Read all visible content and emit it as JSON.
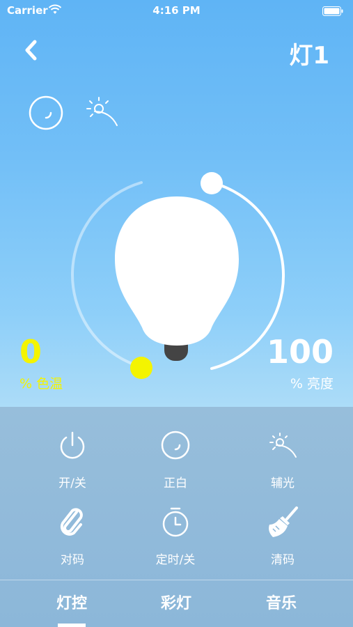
{
  "status_bar": {
    "carrier": "Carrier",
    "time": "4:16 PM"
  },
  "header": {
    "title": "灯1"
  },
  "modes": [
    {
      "icon": "white-light-icon"
    },
    {
      "icon": "auxiliary-light-icon"
    }
  ],
  "readouts": {
    "color_temp": {
      "value": "0",
      "label": "% 色温",
      "color": "#f4f400"
    },
    "brightness": {
      "value": "100",
      "label": "% 亮度"
    }
  },
  "controls": [
    {
      "label": "开/关",
      "icon": "power-icon"
    },
    {
      "label": "正白",
      "icon": "white-light-icon"
    },
    {
      "label": "辅光",
      "icon": "auxiliary-light-icon"
    },
    {
      "label": "对码",
      "icon": "pair-link-icon"
    },
    {
      "label": "定时/关",
      "icon": "timer-icon"
    },
    {
      "label": "清码",
      "icon": "clear-broom-icon"
    }
  ],
  "tabs": [
    {
      "label": "灯控",
      "active": true
    },
    {
      "label": "彩灯",
      "active": false
    },
    {
      "label": "音乐",
      "active": false
    }
  ],
  "colors": {
    "accent_yellow": "#f4f400",
    "panel": "#8cb7d9"
  }
}
